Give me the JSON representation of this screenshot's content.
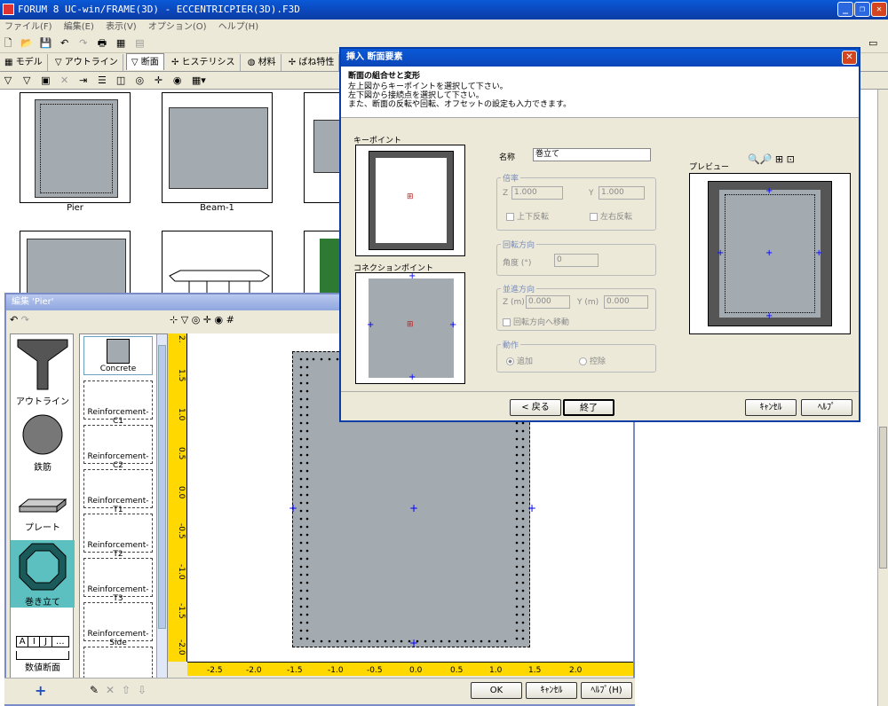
{
  "app": {
    "title": "FORUM 8  UC-win/FRAME(3D) - ECCENTRICPIER(3D).F3D",
    "menu": [
      "ファイル(F)",
      "編集(E)",
      "表示(V)",
      "オプション(O)",
      "ヘルプ(H)"
    ],
    "tabs": [
      "モデル",
      "アウトライン",
      "断面",
      "ヒステリシス",
      "材料",
      "ばね特性"
    ],
    "thumbnails": [
      {
        "label": "Pier"
      },
      {
        "label": "Beam-1"
      }
    ]
  },
  "editor": {
    "title": "編集 'Pier'",
    "palette": [
      "アウトライン",
      "鉄筋",
      "プレート",
      "巻き立て",
      "数値断面"
    ],
    "numeric_header": [
      "A",
      "I",
      "J",
      "..."
    ],
    "layers": [
      "Concrete",
      "Reinforcement-C1",
      "Reinforcement-C2",
      "Reinforcement-T1",
      "Reinforcement-T2",
      "Reinforcement-T3",
      "Reinforcement-Side"
    ],
    "ruler_v": [
      "2.",
      "1.5",
      "1.0",
      "0.5",
      "0.0",
      "-0.5",
      "-1.0",
      "-1.5",
      "-2.0"
    ],
    "ruler_h": [
      "-2.5",
      "-2.0",
      "-1.5",
      "-1.0",
      "-0.5",
      "0.0",
      "0.5",
      "1.0",
      "1.5",
      "2.0"
    ],
    "ok": "OK",
    "cancel": "ｷｬﾝｾﾙ",
    "help": "ﾍﾙﾌﾟ(H)"
  },
  "dialog": {
    "title": "挿入 断面要素",
    "heading": "断面の組合せと変形",
    "instructions": [
      "左上図からキーポイントを選択して下さい。",
      "左下図から接続点を選択して下さい。",
      "また、断面の反転や回転、オフセットの設定も入力できます。"
    ],
    "keypoint_label": "キーポイント",
    "connection_label": "コネクションポイント",
    "name_label": "名称",
    "name_value": "巻立て",
    "scale": {
      "label": "倍率",
      "z_label": "Z",
      "z_value": "1.000",
      "y_label": "Y",
      "y_value": "1.000",
      "flip_ud": "上下反転",
      "flip_lr": "左右反転"
    },
    "rotation": {
      "label": "回転方向",
      "angle_label": "角度 (°)",
      "angle_value": "0"
    },
    "translation": {
      "label": "並進方向",
      "z_label": "Z (m)",
      "z_value": "0.000",
      "y_label": "Y (m)",
      "y_value": "0.000",
      "move_rot": "回転方向へ移動"
    },
    "action": {
      "label": "動作",
      "add": "追加",
      "delete": "控除"
    },
    "preview_label": "プレビュー",
    "back": "< 戻る",
    "finish": "終了",
    "cancel": "ｷｬﾝｾﾙ",
    "help": "ﾍﾙﾌﾟ"
  }
}
